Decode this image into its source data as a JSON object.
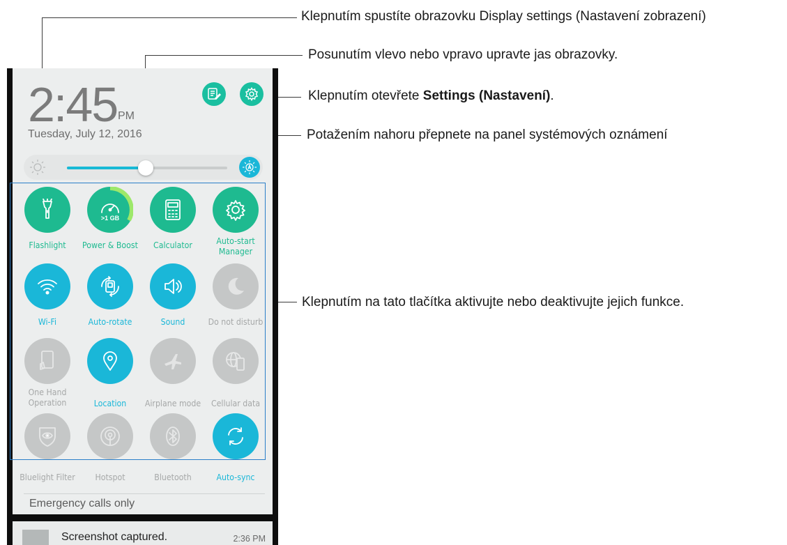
{
  "annotations": {
    "display_settings": "Klepnutím spustíte obrazovku Display settings (Nastavení zobrazení)",
    "brightness": "Posunutím vlevo nebo vpravo upravte jas obrazovky.",
    "settings_prefix": "Klepnutím otevřete ",
    "settings_bold": "Settings (Nastavení)",
    "settings_suffix": ".",
    "swipe_up": "Potažením nahoru přepnete na panel systémových oznámení",
    "toggles": "Klepnutím na tato tlačítka aktivujte nebo deaktivujte jejich funkce."
  },
  "status": {
    "time": "2:45",
    "ampm": "PM",
    "date": "Tuesday, July 12, 2016"
  },
  "header_buttons": {
    "notes_icon": "notes-edit-icon",
    "settings_icon": "gear-icon"
  },
  "brightness": {
    "level_percent": 49,
    "sun_icon": "sun-icon",
    "auto_icon": "auto-brightness-icon"
  },
  "tiles": [
    {
      "label": "Flashlight",
      "state": "green",
      "icon": "flashlight-icon"
    },
    {
      "label": "Power & Boost",
      "state": "green",
      "icon": "speedometer-icon",
      "badge": ">1 GB"
    },
    {
      "label": "Calculator",
      "state": "green",
      "icon": "calculator-icon"
    },
    {
      "label": "Auto-start Manager",
      "state": "green",
      "icon": "gear-icon"
    },
    {
      "label": "Wi-Fi",
      "state": "blue",
      "icon": "wifi-icon"
    },
    {
      "label": "Auto-rotate",
      "state": "blue",
      "icon": "rotate-icon"
    },
    {
      "label": "Sound",
      "state": "blue",
      "icon": "speaker-icon"
    },
    {
      "label": "Do not disturb",
      "state": "gray",
      "icon": "moon-icon"
    },
    {
      "label": "One Hand Operation",
      "state": "gray",
      "icon": "one-hand-icon"
    },
    {
      "label": "Location",
      "state": "blue",
      "icon": "location-pin-icon"
    },
    {
      "label": "Airplane mode",
      "state": "gray",
      "icon": "airplane-icon"
    },
    {
      "label": "Cellular data",
      "state": "gray",
      "icon": "globe-phone-icon"
    },
    {
      "label": "Bluelight Filter",
      "state": "gray",
      "icon": "eye-shield-icon"
    },
    {
      "label": "Hotspot",
      "state": "gray",
      "icon": "hotspot-icon"
    },
    {
      "label": "Bluetooth",
      "state": "gray",
      "icon": "bluetooth-icon"
    },
    {
      "label": "Auto-sync",
      "state": "blue",
      "icon": "sync-icon"
    }
  ],
  "emergency": "Emergency calls only",
  "notification": {
    "title": "Screenshot captured.",
    "time": "2:36 PM"
  },
  "colors": {
    "green": "#1eba90",
    "blue": "#1ab7d8",
    "gray": "#c5c7c7",
    "panel_bg": "#eceeee"
  }
}
